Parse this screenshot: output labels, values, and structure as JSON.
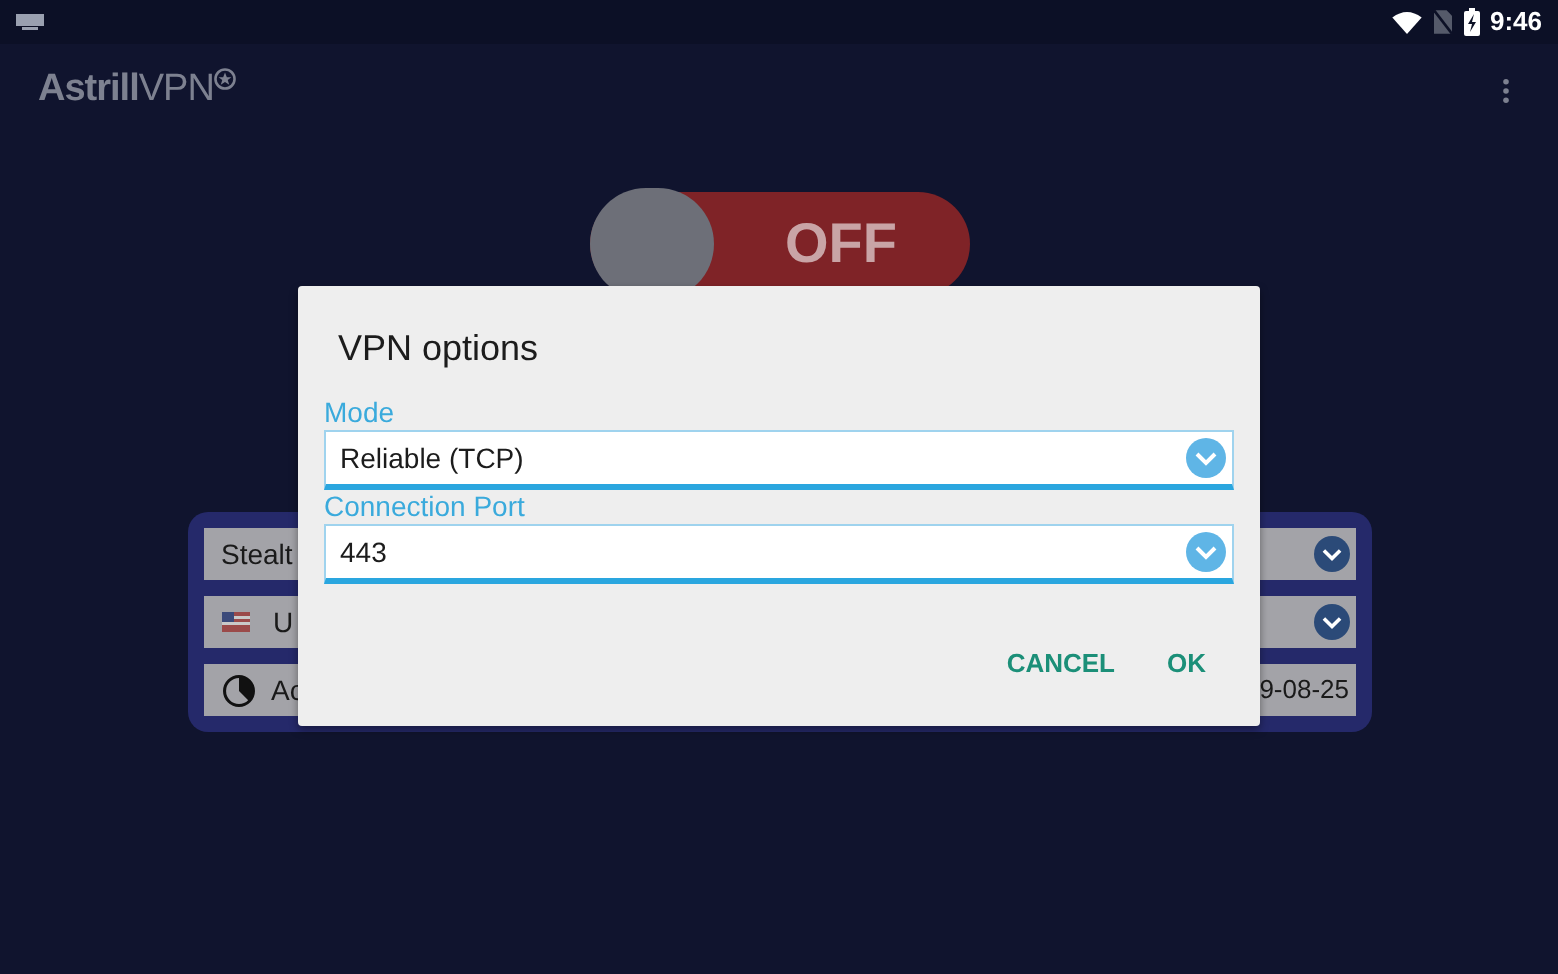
{
  "status_bar": {
    "time": "9:46"
  },
  "app_bar": {
    "logo": "**Astrill**VPN"
  },
  "power_toggle": {
    "label": "OFF",
    "on": false
  },
  "settings_rows": [
    {
      "kind": "select",
      "text": "Stealt"
    },
    {
      "kind": "country",
      "text": "U"
    },
    {
      "kind": "info",
      "text": "Ac",
      "value": "9-08-25"
    }
  ],
  "dialog": {
    "title": "VPN options",
    "fields": [
      {
        "label": "Mode",
        "value": "Reliable (TCP)"
      },
      {
        "label": "Connection Port",
        "value": "443"
      }
    ],
    "buttons": [
      "CANCEL",
      "OK"
    ]
  }
}
